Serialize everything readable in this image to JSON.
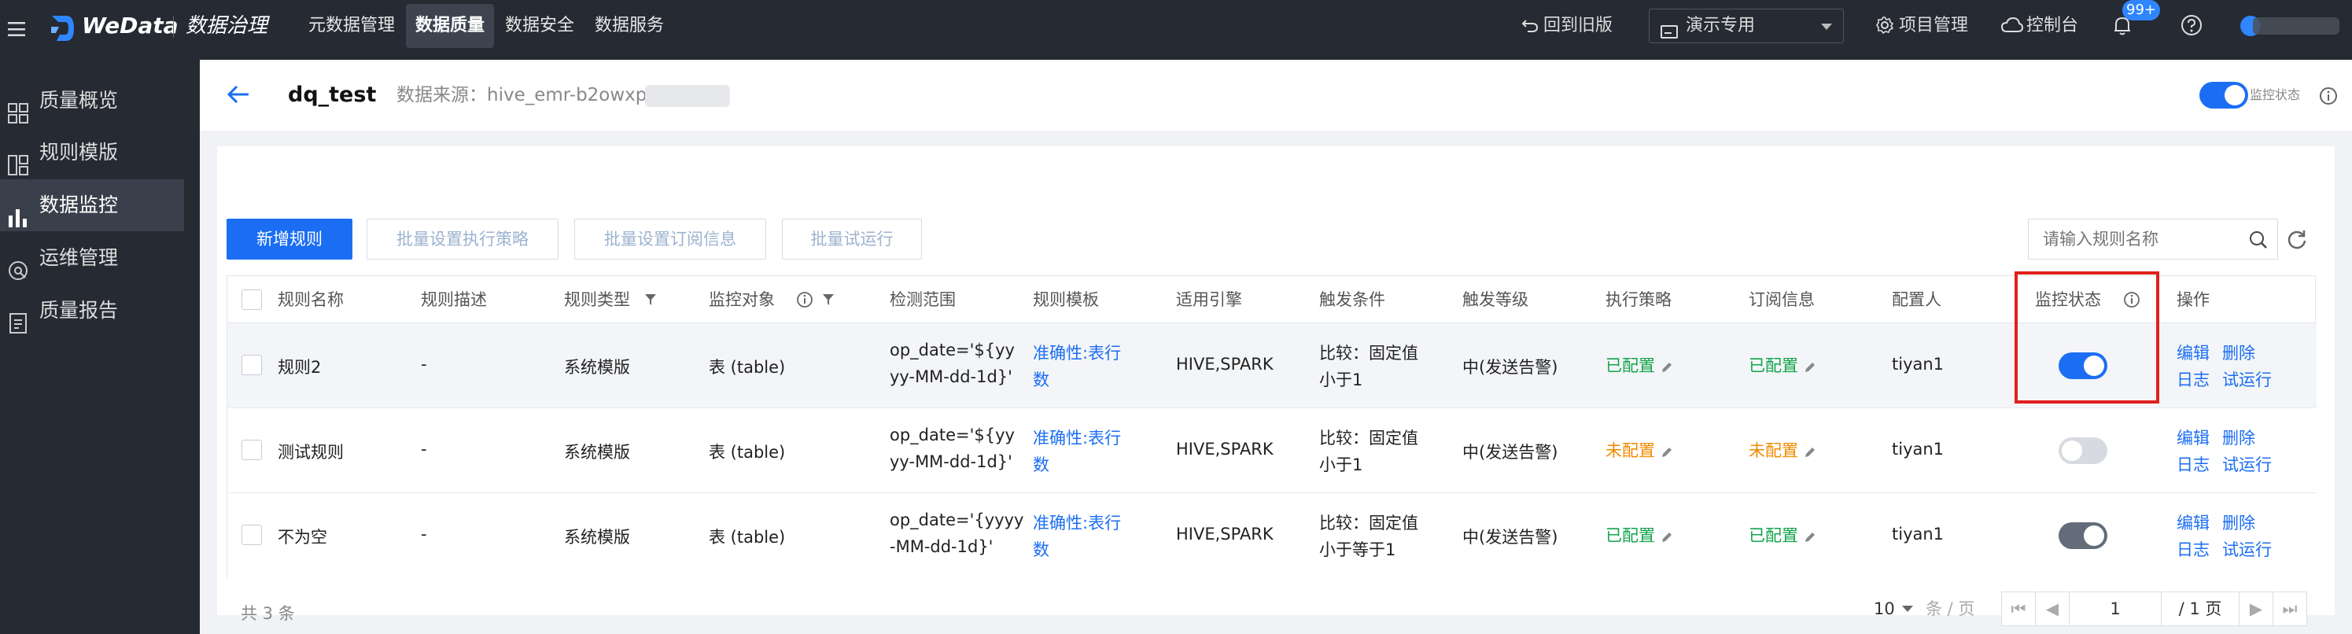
{
  "topbar": {
    "brand": "WeData",
    "product": "数据治理",
    "nav": [
      "元数据管理",
      "数据质量",
      "数据安全",
      "数据服务"
    ],
    "active_nav_index": 1,
    "back_old": "回到旧版",
    "project": "演示专用",
    "project_mgmt": "项目管理",
    "console": "控制台",
    "notif_badge": "99+"
  },
  "sidebar": {
    "items": [
      {
        "label": "质量概览",
        "icon": "grid-icon"
      },
      {
        "label": "规则模版",
        "icon": "template-icon"
      },
      {
        "label": "数据监控",
        "icon": "bar-chart-icon"
      },
      {
        "label": "运维管理",
        "icon": "ops-icon"
      },
      {
        "label": "质量报告",
        "icon": "report-icon"
      }
    ],
    "active_index": 2
  },
  "header": {
    "title": "dq_test",
    "source_label": "数据来源：hive_emr-b2owxp",
    "monitor_label": "监控状态",
    "monitor_on": true
  },
  "toolbar": {
    "new_rule": "新增规则",
    "batch_strategy": "批量设置执行策略",
    "batch_subscribe": "批量设置订阅信息",
    "batch_trial": "批量试运行",
    "search_placeholder": "请输入规则名称"
  },
  "table": {
    "columns": [
      "规则名称",
      "规则描述",
      "规则类型",
      "监控对象",
      "检测范围",
      "规则模板",
      "适用引擎",
      "触发条件",
      "触发等级",
      "执行策略",
      "订阅信息",
      "配置人",
      "监控状态",
      "操作"
    ],
    "rows": [
      {
        "name": "规则2",
        "desc": "-",
        "type": "系统模版",
        "object": "表 (table)",
        "range1": "op_date='${yy",
        "range2": "yy-MM-dd-1d}'",
        "tpl1": "准确性:表行",
        "tpl2": "数",
        "engine": "HIVE,SPARK",
        "cond1": "比较：固定值",
        "cond2": "小于1",
        "level": "中(发送告警)",
        "strategy": "已配置",
        "strategy_ok": true,
        "subscribe": "已配置",
        "subscribe_ok": true,
        "owner": "tiyan1",
        "monitor_on": true,
        "style": "blue"
      },
      {
        "name": "测试规则",
        "desc": "-",
        "type": "系统模版",
        "object": "表 (table)",
        "range1": "op_date='${yy",
        "range2": "yy-MM-dd-1d}'",
        "tpl1": "准确性:表行",
        "tpl2": "数",
        "engine": "HIVE,SPARK",
        "cond1": "比较：固定值",
        "cond2": "小于1",
        "level": "中(发送告警)",
        "strategy": "未配置",
        "strategy_ok": false,
        "subscribe": "未配置",
        "subscribe_ok": false,
        "owner": "tiyan1",
        "monitor_on": false,
        "style": "off"
      },
      {
        "name": "不为空",
        "desc": "-",
        "type": "系统模版",
        "object": "表 (table)",
        "range1": "op_date='{yyyy",
        "range2": "-MM-dd-1d}'",
        "tpl1": "准确性:表行",
        "tpl2": "数",
        "engine": "HIVE,SPARK",
        "cond1": "比较：固定值",
        "cond2": "小于等于1",
        "level": "中(发送告警)",
        "strategy": "已配置",
        "strategy_ok": true,
        "subscribe": "已配置",
        "subscribe_ok": true,
        "owner": "tiyan1",
        "monitor_on": true,
        "style": "gray"
      }
    ],
    "actions": {
      "edit": "编辑",
      "delete": "删除",
      "log": "日志",
      "trial": "试运行"
    }
  },
  "footer": {
    "total": "共 3 条",
    "page_size": "10",
    "per_page": "条 / 页",
    "page_input": "1",
    "page_total": "/ 1 页"
  },
  "colors": {
    "accent": "#1b6ef3",
    "highlight_box": "#e0201d",
    "ok": "#12a34a",
    "warn": "#f08a00"
  }
}
